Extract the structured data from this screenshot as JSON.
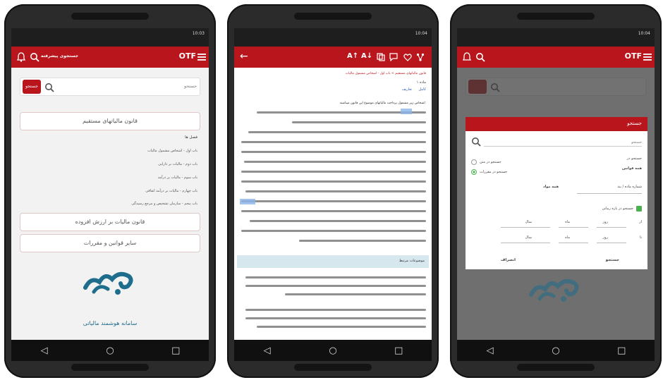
{
  "phones": [
    {
      "status_time": "10:03",
      "header_title": "جستجوی پیشرفته",
      "search_placeholder": "جستجو",
      "search_button": "جستجو",
      "cards": [
        "قانون مالیاتهای مستقیم",
        "قانون مالیات بر ارزش افزوده",
        "سایر قوانین و مقررات"
      ],
      "section_title": "فصل ها",
      "list_items": [
        "باب اول - اشخاص مشمول مالیات",
        "باب دوم - مالیات بر دارایی",
        "باب سوم - مالیات بر درآمد",
        "باب چهارم - مالیات بر درآمد اتفاقی",
        "باب پنجم - سازمان تشخیص و مرجع رسیدگی"
      ],
      "logo_text": "سامانه هوشمند مالیاتی"
    },
    {
      "status_time": "10:04",
      "breadcrumb": "قانون مالیاتهای مستقیم > باب اول - اشخاص مشمول مالیات",
      "article_label": "ماده ۱",
      "tab_labels": [
        "کامل",
        "تعاریف"
      ],
      "body_intro": "اشخاص زیر مشمول پرداخت مالیاتهای موضوع این قانون میباشند:",
      "related_heading": "موضوعات مرتبط"
    },
    {
      "status_time": "10:04",
      "dialog_title": "جستجو",
      "dialog_search_placeholder": "جستجو",
      "search_in_label": "جستجو در",
      "radio_options": [
        "جستجو در متن",
        "جستجو در مقررات"
      ],
      "all_laws_label": "همه قوانین",
      "article_number_label": "شماره ماده / بند",
      "all_articles_label": "همه مواد",
      "search_in_date_label": "جستجو در بازه زمانی",
      "date_labels": [
        "از",
        "روز",
        "ماه",
        "سال",
        "تا",
        "روز",
        "ماه",
        "سال"
      ],
      "search_button": "جستجو",
      "cancel_button": "انصراف"
    }
  ],
  "colors": {
    "brand": "#b8161c",
    "status_bar": "#1e1e1e",
    "nav_bar": "#101010",
    "logo": "#1f6d8c"
  }
}
